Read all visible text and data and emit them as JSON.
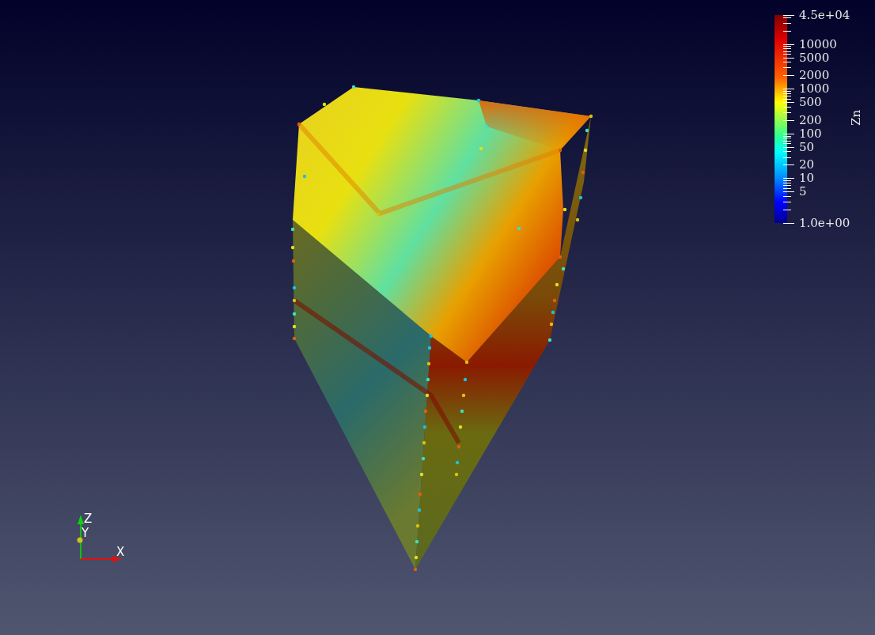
{
  "colorbar": {
    "title": "Zn",
    "labels": [
      "4.5e+04",
      "10000",
      "5000",
      "2000",
      "1000",
      "500",
      "200",
      "100",
      "50",
      "20",
      "10",
      "5",
      "1.0e+00"
    ]
  },
  "axes": {
    "labels": [
      "Z",
      "Y",
      "X"
    ]
  }
}
